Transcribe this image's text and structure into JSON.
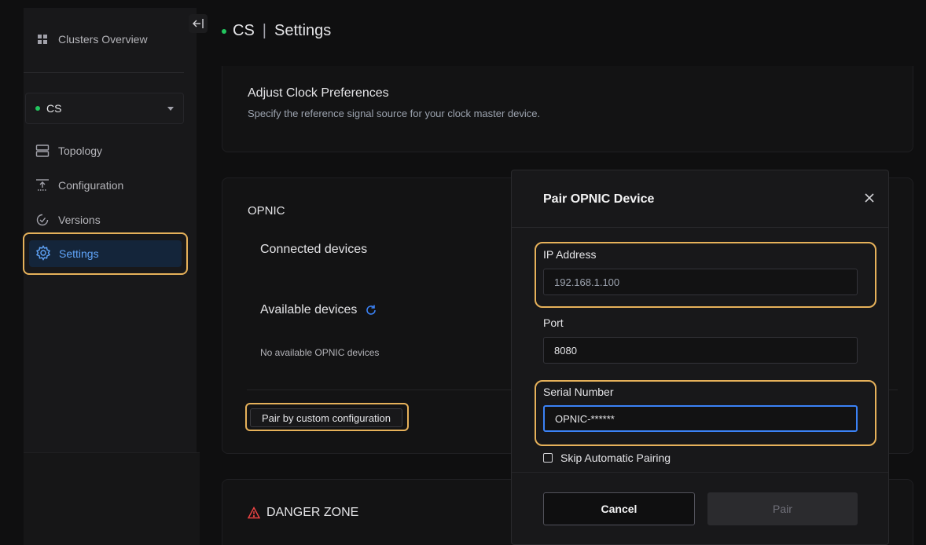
{
  "sidebar": {
    "overview_label": "Clusters Overview",
    "cluster_name": "CS",
    "items": [
      {
        "label": "Topology",
        "icon": "layers-icon"
      },
      {
        "label": "Configuration",
        "icon": "upload-icon"
      },
      {
        "label": "Versions",
        "icon": "clock-check-icon"
      },
      {
        "label": "Settings",
        "icon": "gear-icon"
      }
    ]
  },
  "header": {
    "cluster": "CS",
    "separator": "|",
    "title": "Settings"
  },
  "clock": {
    "title": "Adjust Clock Preferences",
    "subtitle": "Specify the reference signal source for your clock master device."
  },
  "opnic": {
    "title": "OPNIC",
    "connected_label": "Connected devices",
    "available_label": "Available devices",
    "empty_text": "No available OPNIC devices",
    "pair_custom_label": "Pair by custom configuration"
  },
  "danger": {
    "title": "DANGER ZONE"
  },
  "modal": {
    "title": "Pair OPNIC Device",
    "ip_label": "IP Address",
    "ip_placeholder": "192.168.1.100",
    "port_label": "Port",
    "port_value": "8080",
    "serial_label": "Serial Number",
    "serial_value": "OPNIC-******",
    "skip_label": "Skip Automatic Pairing",
    "cancel_label": "Cancel",
    "pair_label": "Pair"
  },
  "colors": {
    "accent": "#3b82f6",
    "highlight": "#e6b15a",
    "status_ok": "#22c55e",
    "danger": "#ef4444"
  }
}
